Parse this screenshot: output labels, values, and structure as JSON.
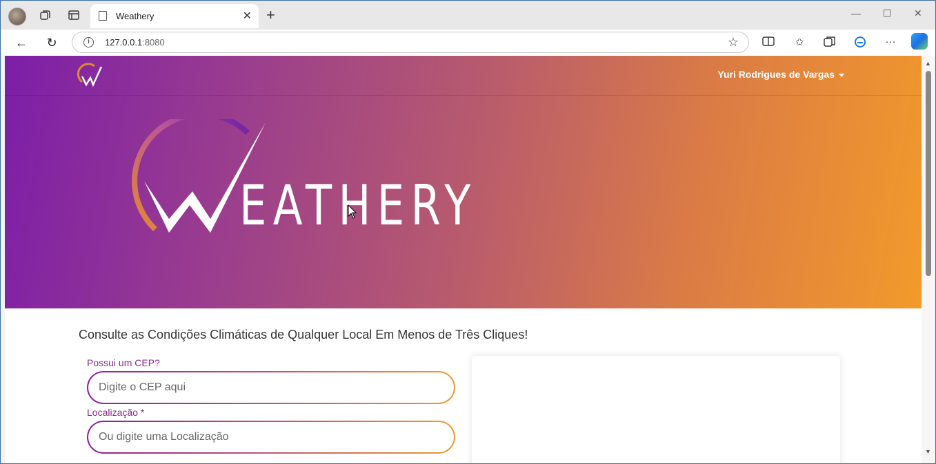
{
  "browser": {
    "tab_title": "Weathery",
    "url_host": "127.0.0.1",
    "url_port": ":8080"
  },
  "header": {
    "user_name": "Yuri Rodrigues de Vargas"
  },
  "hero": {
    "wordmark": "EATHERY"
  },
  "main": {
    "tagline": "Consulte as Condições Climáticas de Qualquer Local Em Menos de Três Cliques!",
    "cep_label": "Possui um CEP?",
    "cep_placeholder": "Digite o CEP aqui",
    "location_label": "Localização *",
    "location_placeholder": "Ou digite uma Localização"
  },
  "icons": [
    "profile-avatar",
    "workspaces-icon",
    "tab-actions-icon",
    "page-icon",
    "close-icon",
    "plus-icon",
    "minimize-icon",
    "maximize-icon",
    "back-icon",
    "refresh-icon",
    "info-icon",
    "favorite-star-icon",
    "split-screen-icon",
    "favorites-icon",
    "collections-icon",
    "edge-icon",
    "more-icon",
    "copilot-icon"
  ],
  "colors": {
    "gradient_start": "#7c1ea8",
    "gradient_end": "#f39a2a",
    "label_color": "#8a2a8a"
  }
}
